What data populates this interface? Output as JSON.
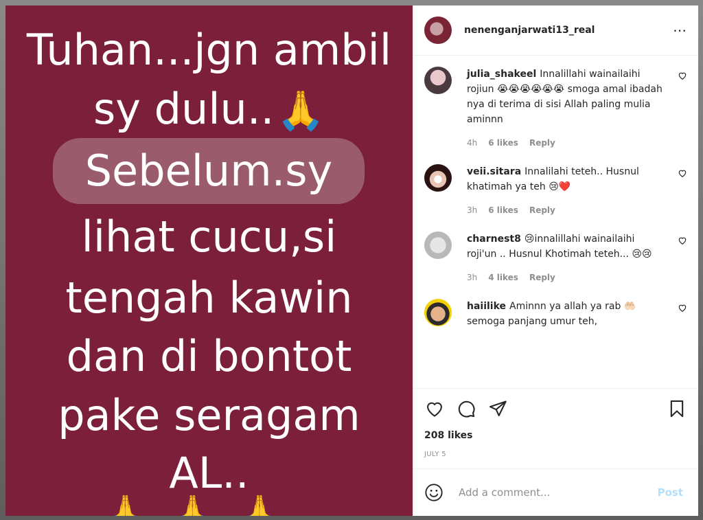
{
  "post": {
    "image_lines": [
      "Tuhan...jgn ambil",
      "sy dulu..",
      "Sebelum.sy",
      "lihat cucu,si",
      "tengah kawin",
      "dan di bontot",
      "pake seragam",
      "AL.."
    ],
    "image_emoji": "🙏",
    "image_bottom_emoji": "🙏🙏🙏",
    "image_bg": "#7b1f3b"
  },
  "header": {
    "owner": "nenenganjarwati13_real",
    "more_icon": "⋯"
  },
  "comments": [
    {
      "user": "julia_shakeel",
      "text": "Innalillahi wainailaihi rojiun 😭😭😭😭😭😭 smoga amal ibadah nya di terima di sisi Allah paling mulia aminnn",
      "time": "4h",
      "likes": "6 likes",
      "reply": "Reply"
    },
    {
      "user": "veii.sitara",
      "text": "Innalilahi teteh.. Husnul khatimah ya teh 😢❤️",
      "time": "3h",
      "likes": "6 likes",
      "reply": "Reply"
    },
    {
      "user": "charnest8",
      "text": "😢innalillahi wainailaihi roji'un .. Husnul Khotimah teteh... 😢😢",
      "time": "3h",
      "likes": "4 likes",
      "reply": "Reply"
    },
    {
      "user": "haiilike",
      "text": "Aminnn ya allah ya rab 🤲🏻 semoga panjang umur teh,",
      "time": "",
      "likes": "",
      "reply": ""
    }
  ],
  "actions": {
    "likes": "208 likes",
    "date": "JULY 5"
  },
  "composer": {
    "placeholder": "Add a comment...",
    "post_label": "Post"
  },
  "colors": {
    "link_disabled": "#b2dffc",
    "text": "#262626",
    "muted": "#8e8e8e"
  }
}
